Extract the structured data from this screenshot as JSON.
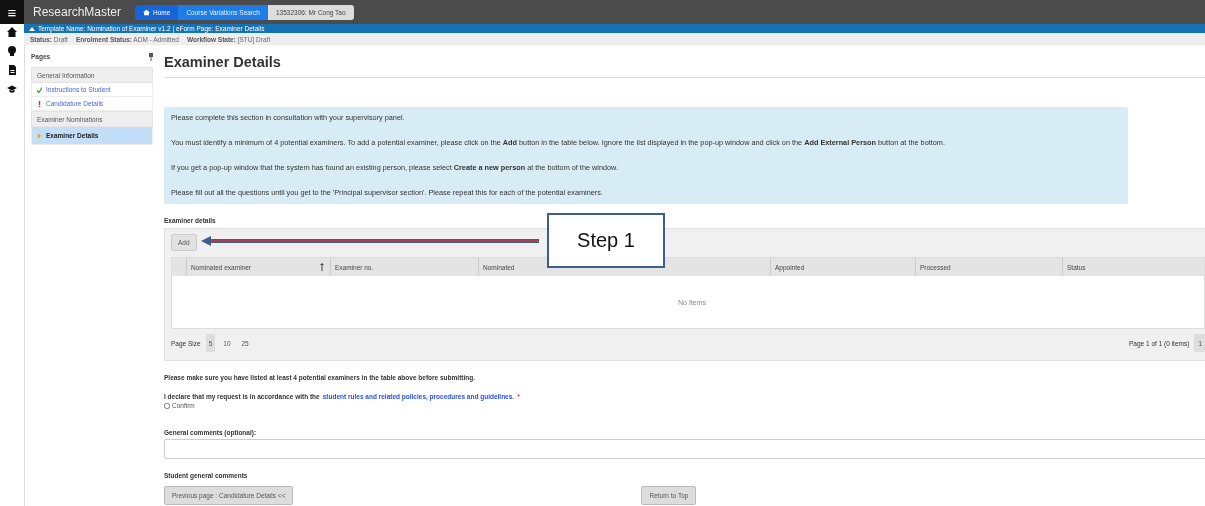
{
  "app": {
    "menu_icon": "≡",
    "title": "ResearchMaster"
  },
  "breadcrumbs": [
    {
      "label": "Home",
      "kind": "home"
    },
    {
      "label": "Course Variations Search",
      "kind": "link"
    },
    {
      "label": "13532306: Mr Cong Tao",
      "kind": "current"
    }
  ],
  "template_bar": {
    "text": "Template Name: Nomination of Examiner v1.2 | eForm Page: Examiner Details"
  },
  "status_bar": [
    {
      "label": "Status:",
      "value": "Draft"
    },
    {
      "label": "Enrolment Status:",
      "value": "ADM - Admitted"
    },
    {
      "label": "Workflow State:",
      "value": "[STU] Draft"
    }
  ],
  "sidebar": {
    "title": "Pages",
    "sections": [
      {
        "label": "General Information",
        "items": [
          {
            "label": "Instructions to Student",
            "kind": "complete",
            "selected": false
          },
          {
            "label": "Candidature Details",
            "kind": "error",
            "selected": false
          }
        ]
      },
      {
        "label": "Examiner Nominations",
        "items": [
          {
            "label": "Examiner Details",
            "kind": "current",
            "selected": true
          }
        ]
      }
    ]
  },
  "page": {
    "title": "Examiner Details",
    "info": [
      "Please complete this section in consultation with your supervisory panel.",
      "You must identify a minimum of 4 potential examiners. To add a potential examiner, please click on the **Add** button in the table below. Ignore the list displayed in the pop-up window and click on the **Add External Person** button at the bottom.",
      "If you get a pop-up window that the system has found an existing person, please select **Create a new person** at the bottom of the window.",
      "Please fill out all the questions until you get to the 'Principal supervisor section'. Please repeat this for each of the potential examiners."
    ],
    "table_label": "Examiner details",
    "add_button": "Add",
    "table": {
      "columns": [
        {
          "label": "Nominated examiner",
          "sorted": true
        },
        {
          "label": "Examiner no.",
          "sorted": false
        },
        {
          "label": "Nominated",
          "sorted": false
        },
        {
          "label": "Appointed",
          "sorted": false
        },
        {
          "label": "Processed",
          "sorted": false
        },
        {
          "label": "Status",
          "sorted": false
        }
      ],
      "empty_text": "No Items"
    },
    "pager": {
      "label": "Page Size",
      "sizes": [
        {
          "label": "5",
          "selected": true
        },
        {
          "label": "10",
          "selected": false
        },
        {
          "label": "25",
          "selected": false
        }
      ],
      "summary": "Page 1 of 1 (0 items)",
      "pages": [
        {
          "label": "1",
          "selected": true
        }
      ]
    },
    "warning": "Please make sure you have listed at least 4 potential examiners in the table above before submitting.",
    "declaration": {
      "text": "I declare that my request is in accordance with the",
      "link": "student rules and related policies, procedures and guidelines.",
      "required_mark": "*",
      "checkbox_label": "Confirm",
      "checked": false
    },
    "comments": {
      "label": "General comments (optional):"
    },
    "student_comments_label": "Student general comments",
    "buttons": [
      {
        "label": "Previous page : Candidature Details <<"
      },
      {
        "label": "Return to Top"
      }
    ]
  },
  "callout": {
    "text": "Step 1"
  }
}
